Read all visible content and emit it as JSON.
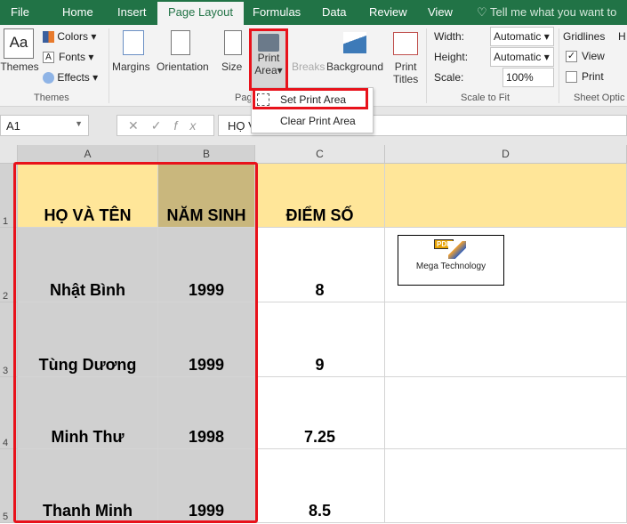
{
  "tabs": [
    "File",
    "Home",
    "Insert",
    "Page Layout",
    "Formulas",
    "Data",
    "Review",
    "View"
  ],
  "tell_me": "Tell me what you want to do...",
  "ribbon": {
    "themes": "Themes",
    "colors": "Colors",
    "fonts": "Fonts",
    "effects": "Effects",
    "themes_group": "Themes",
    "margins": "Margins",
    "orientation": "Orientation",
    "size": "Size",
    "print": "Print",
    "area": "Area",
    "breaks": "Breaks",
    "background": "Background",
    "print_titles_1": "Print",
    "print_titles_2": "Titles",
    "page_group": "Pag",
    "width_label": "Width:",
    "width_value": "Automatic",
    "height_label": "Height:",
    "height_value": "Automatic",
    "scale_label": "Scale:",
    "scale_value": "100%",
    "scale_group": "Scale to Fit",
    "gridlines": "Gridlines",
    "headings": "H",
    "view": "View",
    "print_opt": "Print",
    "sheet_group": "Sheet Optic",
    "gridlines_view_checked": true,
    "gridlines_print_checked": false
  },
  "print_area_menu": {
    "set": "Set Print Area",
    "clear": "Clear Print Area"
  },
  "formula_bar": {
    "name_box": "A1",
    "content": "HỌ V"
  },
  "columns": [
    "A",
    "B",
    "C",
    "D"
  ],
  "rows": [
    {
      "num": "1",
      "cells": [
        "HỌ VÀ TÊN",
        "NĂM SINH",
        "ĐIỂM SỐ",
        ""
      ]
    },
    {
      "num": "2",
      "cells": [
        "Nhật Bình",
        "1999",
        "8",
        ""
      ]
    },
    {
      "num": "3",
      "cells": [
        "Tùng Dương",
        "1999",
        "9",
        ""
      ]
    },
    {
      "num": "4",
      "cells": [
        "Minh Thư",
        "1998",
        "7.25",
        ""
      ]
    },
    {
      "num": "5",
      "cells": [
        "Thanh Minh",
        "1999",
        "8.5",
        ""
      ]
    }
  ],
  "logo": {
    "badge": "PDF",
    "text": "Mega Technology"
  },
  "colors": {
    "accent": "#217346",
    "highlight": "#e8121b",
    "header_fill": "#ffe699",
    "selection": "#d0d0d0"
  }
}
